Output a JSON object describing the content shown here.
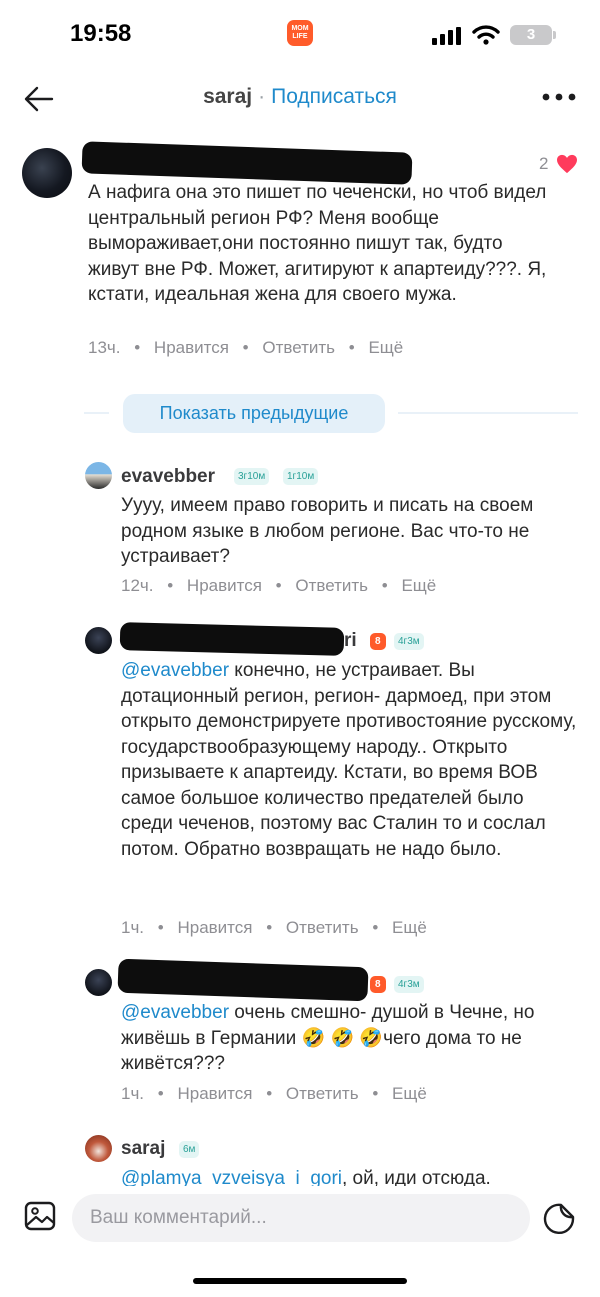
{
  "status_bar": {
    "time": "19:58",
    "app_badge": "MOM LIFE",
    "battery": "3"
  },
  "header": {
    "username": "saraj",
    "separator": "·",
    "subscribe": "Подписаться"
  },
  "comments": [
    {
      "likes": "2",
      "text": "А нафига она это пишет по чеченски, но чтоб видел центральный регион РФ? Меня вообще вымораживает,они постоянно пишут так, будто живут вне РФ. Может, агитируют к апартеиду???. Я, кстати, идеальная жена для своего мужа.",
      "time": "13ч.",
      "like": "Нравится",
      "reply": "Ответить",
      "more": "Ещё"
    }
  ],
  "show_previous": "Показать предыдущие",
  "replies": [
    {
      "username": "evavebber",
      "tags": [
        "3г10м",
        "1г10м"
      ],
      "text": "Уууу, имеем право говорить и писать на своем родном языке в любом регионе. Вас что-то не устраивает?",
      "time": "12ч.",
      "like": "Нравится",
      "reply": "Ответить",
      "more": "Ещё"
    },
    {
      "username_tail": "ri",
      "tags": [
        "8",
        "4г3м"
      ],
      "mention": "@evavebber",
      "text": " конечно, не устраивает. Вы дотационный регион, регион- дармоед, при этом открыто демонстрируете противостояние русскому, государствообразующему народу.. Открыто призываете к апартеиду. Кстати, во время ВОВ самое большое количество предателей было среди чеченов, поэтому вас Сталин то и сослал потом. Обратно возвращать не надо было.",
      "time": "1ч.",
      "like": "Нравится",
      "reply": "Ответить",
      "more": "Ещё"
    },
    {
      "tags": [
        "8",
        "4г3м"
      ],
      "mention": "@evavebber",
      "text_a": " очень смешно- душой в Чечне, но живёшь в Германии ",
      "emojis": "🤣 🤣 🤣",
      "text_b": "чего дома то не живётся???",
      "time": "1ч.",
      "like": "Нравится",
      "reply": "Ответить",
      "more": "Ещё"
    },
    {
      "username": "saraj",
      "tags": [
        "6м"
      ],
      "mention": "@plamya_vzveisya_i_gori",
      "text": ", ой, иди отсюда."
    }
  ],
  "composer": {
    "placeholder": "Ваш комментарий..."
  },
  "icons": [
    "back-arrow-icon",
    "more-dots-icon",
    "heart-icon",
    "image-icon",
    "sticker-icon",
    "signal-icon",
    "wifi-icon"
  ],
  "colors": {
    "accent": "#1f8acb",
    "heart": "#ff3b5c",
    "tag_teal": "#2aa198",
    "tag_orange": "#ff5a2a"
  }
}
